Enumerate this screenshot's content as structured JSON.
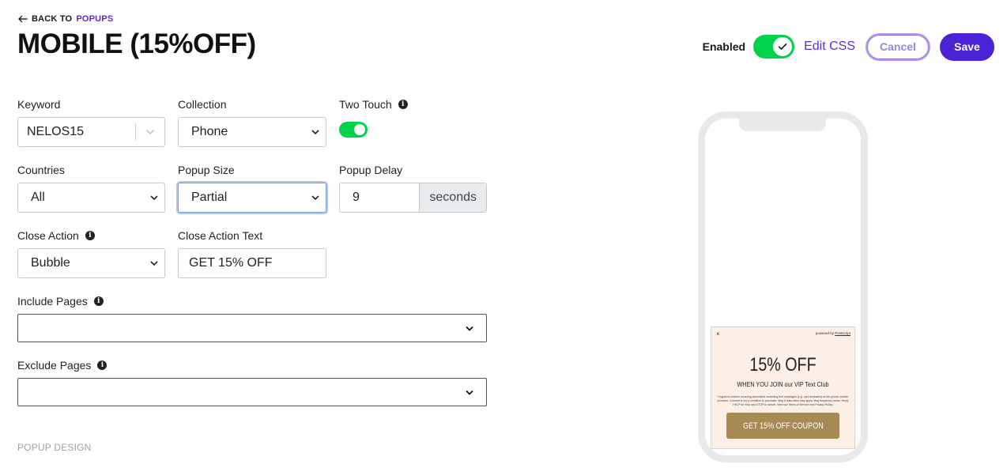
{
  "header": {
    "back_prefix": "BACK TO",
    "back_target": "POPUPS",
    "title": "MOBILE (15%OFF)",
    "enabled_label": "Enabled",
    "enabled": true,
    "edit_css_label": "Edit CSS",
    "cancel_label": "Cancel",
    "save_label": "Save"
  },
  "form": {
    "keyword": {
      "label": "Keyword",
      "value": "NELOS15"
    },
    "collection": {
      "label": "Collection",
      "value": "Phone"
    },
    "two_touch": {
      "label": "Two Touch",
      "enabled": true
    },
    "countries": {
      "label": "Countries",
      "value": "All"
    },
    "popup_size": {
      "label": "Popup Size",
      "value": "Partial"
    },
    "popup_delay": {
      "label": "Popup Delay",
      "value": "9",
      "unit": "seconds"
    },
    "close_action": {
      "label": "Close Action",
      "value": "Bubble"
    },
    "close_action_text": {
      "label": "Close Action Text",
      "value": "GET 15% OFF"
    },
    "include_pages": {
      "label": "Include Pages",
      "value": ""
    },
    "exclude_pages": {
      "label": "Exclude Pages",
      "value": ""
    },
    "section_popup_design": "POPUP DESIGN"
  },
  "preview": {
    "close": "×",
    "powered_prefix": "powered by",
    "powered_brand": "Postscript",
    "headline": "15% OFF",
    "subheadline": "WHEN YOU JOIN our VIP Text Club",
    "fine_print": "*I agree to receive recurring automated marketing text messages (e.g. cart reminders) at the phone number provided. Consent is not a condition to purchase. Msg & data rates may apply. Msg frequency varies. Reply HELP for help and STOP to cancel. View our Terms of Service and Privacy Policy.",
    "cta": "GET 15% OFF COUPON",
    "colors": {
      "background": "#fbefe6",
      "button": "#a88a55"
    }
  },
  "colors": {
    "accent": "#5a2bd6",
    "save": "#4b22d6",
    "toggle_on": "#00d34a"
  }
}
